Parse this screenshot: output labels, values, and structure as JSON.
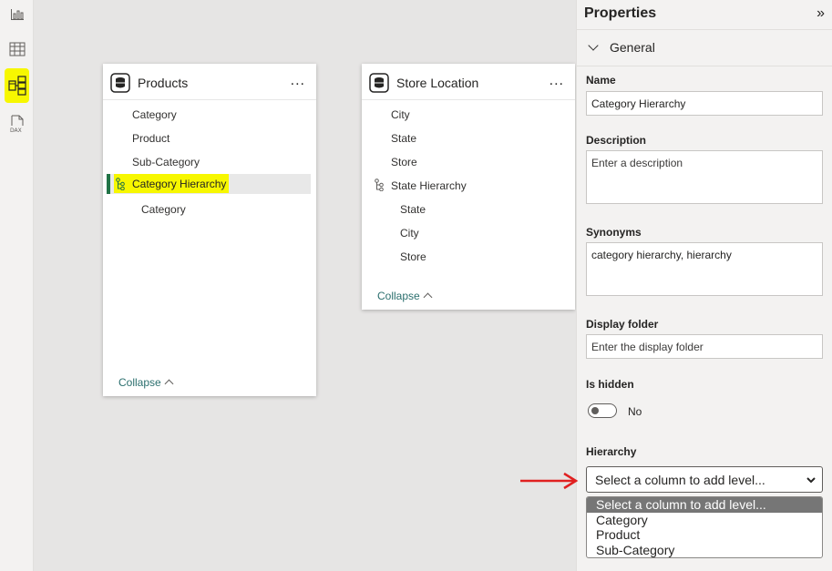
{
  "rail": {
    "items": [
      {
        "name": "report-view",
        "icon": "bar-chart-icon"
      },
      {
        "name": "table-view",
        "icon": "table-icon"
      },
      {
        "name": "model-view",
        "icon": "model-icon",
        "active": true
      },
      {
        "name": "dax-query-view",
        "icon": "dax-icon"
      }
    ]
  },
  "tables": {
    "products": {
      "title": "Products",
      "more": "...",
      "fields": [
        "Category",
        "Product",
        "Sub-Category"
      ],
      "hierarchy": "Category Hierarchy",
      "hierarchy_levels": [
        "Category"
      ],
      "collapse": "Collapse"
    },
    "store": {
      "title": "Store Location",
      "more": "...",
      "fields": [
        "City",
        "State",
        "Store"
      ],
      "hierarchy": "State Hierarchy",
      "hierarchy_levels": [
        "State",
        "City",
        "Store"
      ],
      "collapse": "Collapse"
    }
  },
  "properties": {
    "title": "Properties",
    "collapse_glyph": "»",
    "section": "General",
    "name_label": "Name",
    "name_value": "Category Hierarchy",
    "description_label": "Description",
    "description_placeholder": "Enter a description",
    "synonyms_label": "Synonyms",
    "synonyms_value": "category hierarchy, hierarchy",
    "display_folder_label": "Display folder",
    "display_folder_placeholder": "Enter the display folder",
    "is_hidden_label": "Is hidden",
    "is_hidden_value": "No",
    "hierarchy_label": "Hierarchy",
    "hierarchy_select_value": "Select a column to add level...",
    "hierarchy_options": [
      "Select a column to add level...",
      "Category",
      "Product",
      "Sub-Category"
    ]
  },
  "colors": {
    "highlight": "#f7f700",
    "accent_green": "#217346",
    "annotation_arrow": "#e02020"
  }
}
